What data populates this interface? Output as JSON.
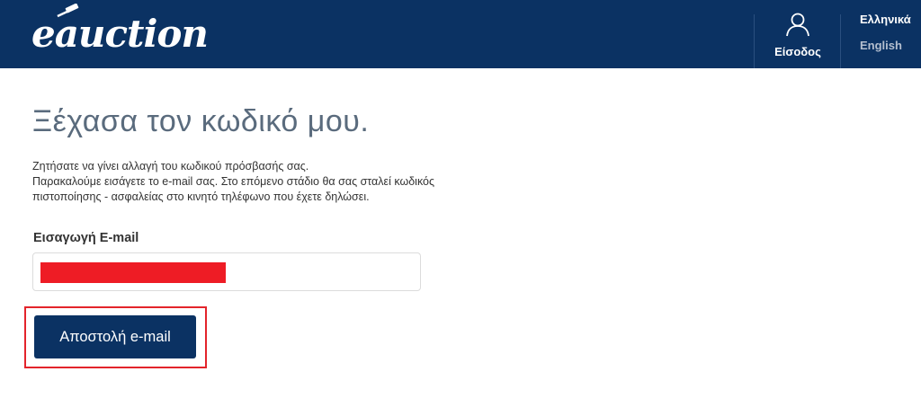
{
  "header": {
    "logo_text": "eauction",
    "login_label": "Είσοδος",
    "languages": [
      {
        "label": "Ελληνικά",
        "active": true
      },
      {
        "label": "English",
        "active": false
      }
    ]
  },
  "main": {
    "title": "Ξέχασα τον κωδικό μου.",
    "intro_lines": [
      "Ζητήσατε να γίνει αλλαγή του κωδικού πρόσβασής σας.",
      "Παρακαλούμε εισάγετε το e-mail σας. Στο επόμενο στάδιο θα σας σταλεί κωδικός",
      "πιστοποίησης - ασφαλείας στο κινητό τηλέφωνο που έχετε δηλώσει."
    ],
    "email_label": "Εισαγωγή E-mail",
    "email_value": "",
    "submit_label": "Αποστολή e-mail"
  },
  "colors": {
    "header_bg": "#0b3263",
    "button_bg": "#0b3263",
    "title_color": "#5a6b7d",
    "redaction": "#ee1c25",
    "highlight_border": "#e3242b"
  },
  "icons": {
    "login": "user-icon",
    "logo_mark": "gavel-icon"
  }
}
